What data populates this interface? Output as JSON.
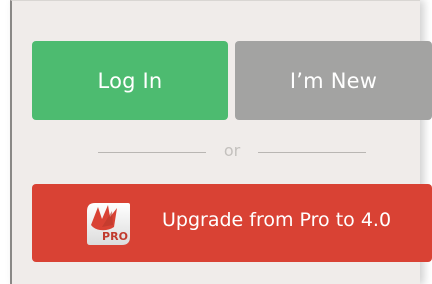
{
  "auth": {
    "login_label": "Log In",
    "new_label": "I’m New",
    "divider_text": "or"
  },
  "upgrade": {
    "label": "Upgrade from Pro to 4.0",
    "badge_text": "PRO"
  },
  "colors": {
    "login": "#4dbb70",
    "new": "#a3a3a2",
    "upgrade": "#d94234",
    "panel": "#f0ecea"
  },
  "icons": {
    "pro": "pro-app-icon"
  }
}
